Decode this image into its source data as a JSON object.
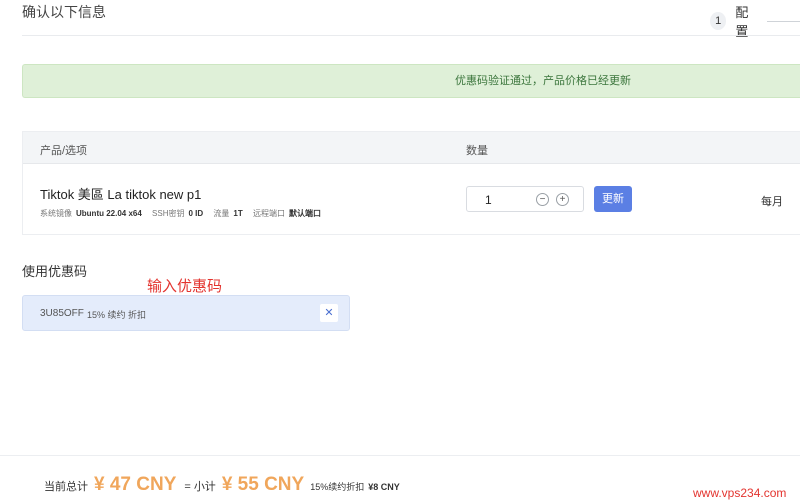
{
  "header": {
    "title": "确认以下信息",
    "step_number": "1",
    "step_label": "配置"
  },
  "alert": {
    "message": "优惠码验证通过，产品价格已经更新",
    "color": "#dff0d8"
  },
  "table": {
    "headers": {
      "product": "产品/选项",
      "quantity": "数量"
    },
    "row": {
      "name": "Tiktok 美區 La tiktok new p1",
      "meta": [
        {
          "label": "系统镜像",
          "value": "Ubuntu 22.04 x64"
        },
        {
          "label": "SSH密钥",
          "value": "0 ID"
        },
        {
          "label": "流量",
          "value": "1T"
        },
        {
          "label": "远程端口",
          "value": "默认端口"
        }
      ],
      "quantity": "1",
      "minus_icon": "minus-circle-icon",
      "plus_icon": "plus-circle-icon",
      "update_label": "更新",
      "billing_cycle": "每月"
    }
  },
  "coupon": {
    "title": "使用优惠码",
    "hint": "输入优惠码",
    "code": "3U85OFF",
    "description": "15% 续约 折扣",
    "close_icon": "close-icon"
  },
  "totals": {
    "current_label": "当前总计",
    "current_value": "¥ 47 CNY",
    "equals": "=",
    "subtotal_label": "小计",
    "subtotal_value": "¥ 55 CNY",
    "discount_label": "15%续约折扣",
    "discount_value": "¥8 CNY"
  },
  "watermark": "www.vps234.com",
  "colors": {
    "accent": "#5b7fe4",
    "price": "#f0a65b",
    "hint": "#e3342f",
    "success_text": "#3c763d"
  }
}
